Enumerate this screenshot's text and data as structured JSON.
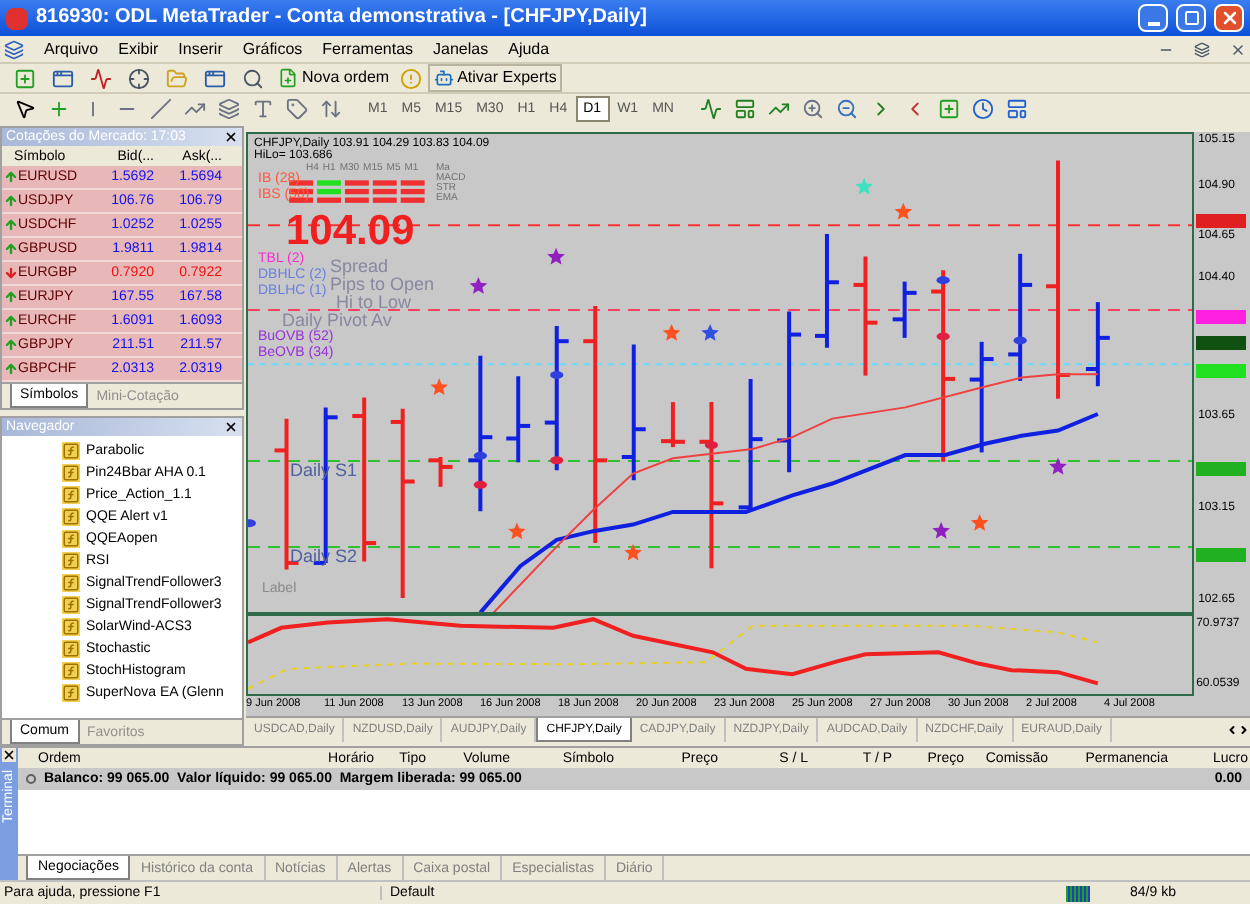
{
  "window": {
    "title": "816930: ODL MetaTrader - Conta demonstrativa - [CHFJPY,Daily]"
  },
  "menu": [
    "Arquivo",
    "Exibir",
    "Inserir",
    "Gráficos",
    "Ferramentas",
    "Janelas",
    "Ajuda"
  ],
  "toolbar": {
    "buttons": [
      "Nova ordem",
      "Ativar Experts"
    ]
  },
  "timeframes": [
    {
      "label": "M1",
      "selected": false
    },
    {
      "label": "M5",
      "selected": false
    },
    {
      "label": "M15",
      "selected": false
    },
    {
      "label": "M30",
      "selected": false
    },
    {
      "label": "H1",
      "selected": false
    },
    {
      "label": "H4",
      "selected": false
    },
    {
      "label": "D1",
      "selected": true
    },
    {
      "label": "W1",
      "selected": false
    },
    {
      "label": "MN",
      "selected": false
    }
  ],
  "market_watch": {
    "title": "Cotações do Mercado: 17:03",
    "columns": [
      "Símbolo",
      "Bid(...",
      "Ask(..."
    ],
    "rows": [
      {
        "symbol": "EURUSD",
        "bid": "1.5692",
        "ask": "1.5694",
        "rising": true
      },
      {
        "symbol": "USDJPY",
        "bid": "106.76",
        "ask": "106.79",
        "rising": true
      },
      {
        "symbol": "USDCHF",
        "bid": "1.0252",
        "ask": "1.0255",
        "rising": true
      },
      {
        "symbol": "GBPUSD",
        "bid": "1.9811",
        "ask": "1.9814",
        "rising": true
      },
      {
        "symbol": "EURGBP",
        "bid": "0.7920",
        "ask": "0.7922",
        "rising": false
      },
      {
        "symbol": "EURJPY",
        "bid": "167.55",
        "ask": "167.58",
        "rising": true
      },
      {
        "symbol": "EURCHF",
        "bid": "1.6091",
        "ask": "1.6093",
        "rising": true
      },
      {
        "symbol": "GBPJPY",
        "bid": "211.51",
        "ask": "211.57",
        "rising": true
      },
      {
        "symbol": "GBPCHF",
        "bid": "2.0313",
        "ask": "2.0319",
        "rising": true
      }
    ],
    "tabs": [
      {
        "label": "Símbolos",
        "selected": true
      },
      {
        "label": "Mini-Cotação",
        "selected": false
      }
    ]
  },
  "navigator": {
    "title": "Navegador",
    "items": [
      "Parabolic",
      "Pin24Bbar AHA 0.1",
      "Price_Action_1.1",
      "QQE Alert v1",
      "QQEAopen",
      "RSI",
      "SignalTrendFollower3",
      "SignalTrendFollower3",
      "SolarWind-ACS3",
      "Stochastic",
      "StochHistogram",
      "SuperNova EA (Glenn"
    ],
    "tabs": [
      {
        "label": "Comum",
        "selected": true
      },
      {
        "label": "Favoritos",
        "selected": false
      }
    ]
  },
  "chart": {
    "header": "CHFJPY,Daily  103.91 104.29 103.83 104.09",
    "hilo": "HiLo= 103.686",
    "timeframe_row": [
      "H4",
      "H1",
      "M30",
      "M15",
      "M5",
      "M1"
    ],
    "indicator_row": [
      "Ma",
      "MACD",
      "STR",
      "EMA"
    ],
    "legend": [
      {
        "text": "IB (28)",
        "color": "#ff5a3c"
      },
      {
        "text": "IBS (50)",
        "color": "#ff5a3c"
      },
      {
        "text": "TBL (2)",
        "color": "#ff2bd0"
      },
      {
        "text": "DBHLC (2)",
        "color": "#6a7fe0"
      },
      {
        "text": "DBLHC (1)",
        "color": "#6a7fe0"
      },
      {
        "text": "BuOVB (52)",
        "color": "#9a30d8"
      },
      {
        "text": "BeOVB (34)",
        "color": "#9a30d8"
      }
    ],
    "price": "104.09",
    "overlay": [
      "Spread",
      "Pips to Open",
      "Hi to Low",
      "Daily Pivot Av"
    ],
    "levels": [
      "Daily S1",
      "Daily S2"
    ],
    "label": "Label",
    "price_axis": [
      "105.15",
      "104.90",
      "104.65",
      "104.40",
      "103.65",
      "103.15",
      "102.65"
    ],
    "sub_axis": [
      "70.9737",
      "60.0539"
    ],
    "dates": [
      "9 Jun 2008",
      "11 Jun 2008",
      "13 Jun 2008",
      "16 Jun 2008",
      "18 Jun 2008",
      "20 Jun 2008",
      "23 Jun 2008",
      "25 Jun 2008",
      "27 Jun 2008",
      "30 Jun 2008",
      "2 Jul 2008",
      "4 Jul 2008"
    ]
  },
  "chart_tabs": [
    {
      "label": "USDCAD,Daily",
      "selected": false
    },
    {
      "label": "NZDUSD,Daily",
      "selected": false
    },
    {
      "label": "AUDJPY,Daily",
      "selected": false
    },
    {
      "label": "CHFJPY,Daily",
      "selected": true
    },
    {
      "label": "CADJPY,Daily",
      "selected": false
    },
    {
      "label": "NZDJPY,Daily",
      "selected": false
    },
    {
      "label": "AUDCAD,Daily",
      "selected": false
    },
    {
      "label": "NZDCHF,Daily",
      "selected": false
    },
    {
      "label": "EURAUD,Daily",
      "selected": false
    }
  ],
  "terminal": {
    "title": "Terminal",
    "columns": [
      "Ordem",
      "Horário",
      "Tipo",
      "Volume",
      "Símbolo",
      "Preço",
      "S / L",
      "T / P",
      "Preço",
      "Comissão",
      "Permanencia",
      "Lucro"
    ],
    "balance": "Balanco: 99 065.00  Valor líquido: 99 065.00  Margem liberada: 99 065.00",
    "profit": "0.00",
    "tabs": [
      {
        "label": "Negociações",
        "selected": true
      },
      {
        "label": "Histórico da conta",
        "selected": false
      },
      {
        "label": "Notícias",
        "selected": false
      },
      {
        "label": "Alertas",
        "selected": false
      },
      {
        "label": "Caixa postal",
        "selected": false
      },
      {
        "label": "Especialistas",
        "selected": false
      },
      {
        "label": "Diário",
        "selected": false
      }
    ]
  },
  "status_bar": [
    "Para ajuda, pressione F1",
    "Default",
    "84/9 kb"
  ]
}
